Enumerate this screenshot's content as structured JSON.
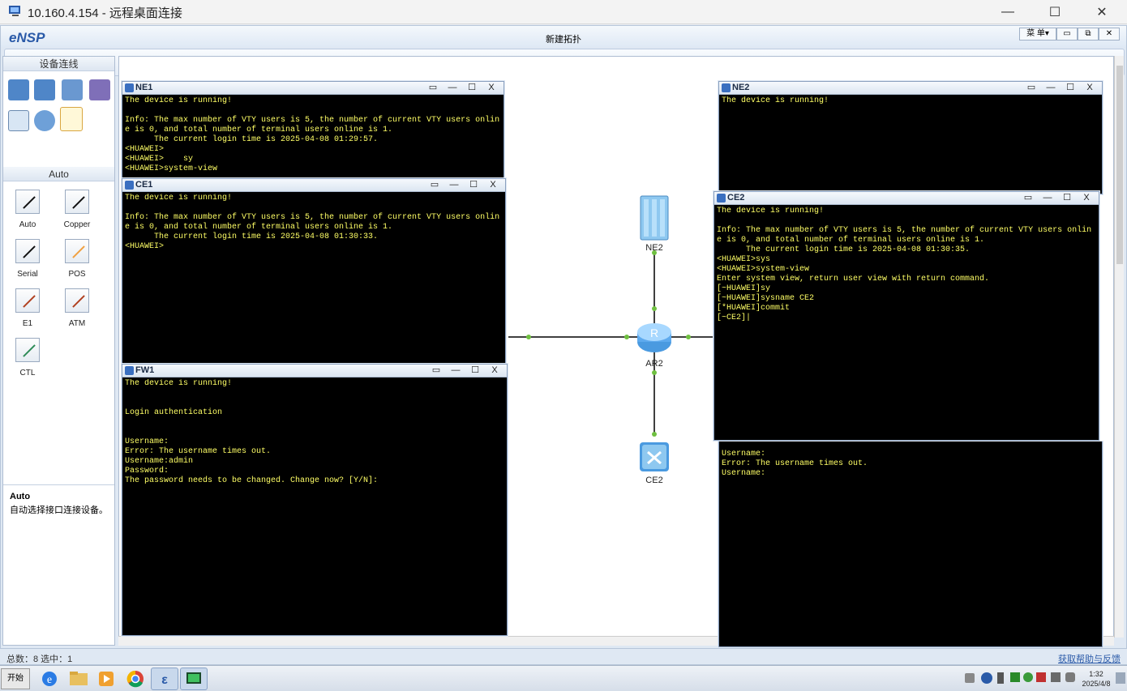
{
  "rdp": {
    "title": "10.160.4.154 - 远程桌面连接",
    "min": "—",
    "max": "☐",
    "close": "✕"
  },
  "ensp": {
    "logo": "eNSP",
    "doc_title": "新建拓扑",
    "menu": {
      "label": "菜 单▾",
      "min": "▭",
      "restore": "⧉",
      "close": "✕"
    }
  },
  "palette": {
    "header_devices": "设备连线",
    "header_links": "Auto",
    "links": [
      {
        "label": "Auto",
        "color": "#111111"
      },
      {
        "label": "Copper",
        "color": "#111111"
      },
      {
        "label": "Serial",
        "color": "#111111"
      },
      {
        "label": "POS",
        "color": "#f0a040"
      },
      {
        "label": "E1",
        "color": "#b04020"
      },
      {
        "label": "ATM",
        "color": "#b04020"
      },
      {
        "label": "CTL",
        "color": "#2e8b57"
      }
    ],
    "desc_title": "Auto",
    "desc_text": "自动选择接口连接设备。"
  },
  "topology": {
    "nodes": [
      {
        "name": "NE2",
        "label": "NE2"
      },
      {
        "name": "AR2",
        "label": "AR2"
      },
      {
        "name": "CE2",
        "label": "CE2"
      }
    ]
  },
  "consoles": {
    "ne1": {
      "title": "NE1",
      "text": "The device is running!\n\nInfo: The max number of VTY users is 5, the number of current VTY users online is 0, and total number of terminal users online is 1.\n      The current login time is 2025-04-08 01:29:57.\n<HUAWEI>\n<HUAWEI>    sy\n<HUAWEI>system-view"
    },
    "ce1": {
      "title": "CE1",
      "text": "The device is running!\n\nInfo: The max number of VTY users is 5, the number of current VTY users online is 0, and total number of terminal users online is 1.\n      The current login time is 2025-04-08 01:30:33.\n<HUAWEI>"
    },
    "fw1": {
      "title": "FW1",
      "text": "The device is running!\n\n\nLogin authentication\n\n\nUsername:\nError: The username times out.\nUsername:admin\nPassword:\nThe password needs to be changed. Change now? [Y/N]:"
    },
    "ne2": {
      "title": "NE2",
      "text": "The device is running!"
    },
    "ce2": {
      "title": "CE2",
      "text": "The device is running!\n\nInfo: The max number of VTY users is 5, the number of current VTY users online is 0, and total number of terminal users online is 1.\n      The current login time is 2025-04-08 01:30:35.\n<HUAWEI>sys\n<HUAWEI>system-view\nEnter system view, return user view with return command.\n[~HUAWEI]sy\n[~HUAWEI]sysname CE2\n[*HUAWEI]commit\n[~CE2]|"
    },
    "fw2": {
      "text": "Username:\nError: The username times out.\nUsername:"
    },
    "buttons": {
      "restore": "▭",
      "min": "—",
      "max": "☐",
      "close": "X"
    }
  },
  "statusbar": {
    "left": "总数：8  选中：1",
    "right": "获取帮助与反馈"
  },
  "taskbar": {
    "start": "开始",
    "time": "1:32",
    "date": "2025/4/8"
  }
}
